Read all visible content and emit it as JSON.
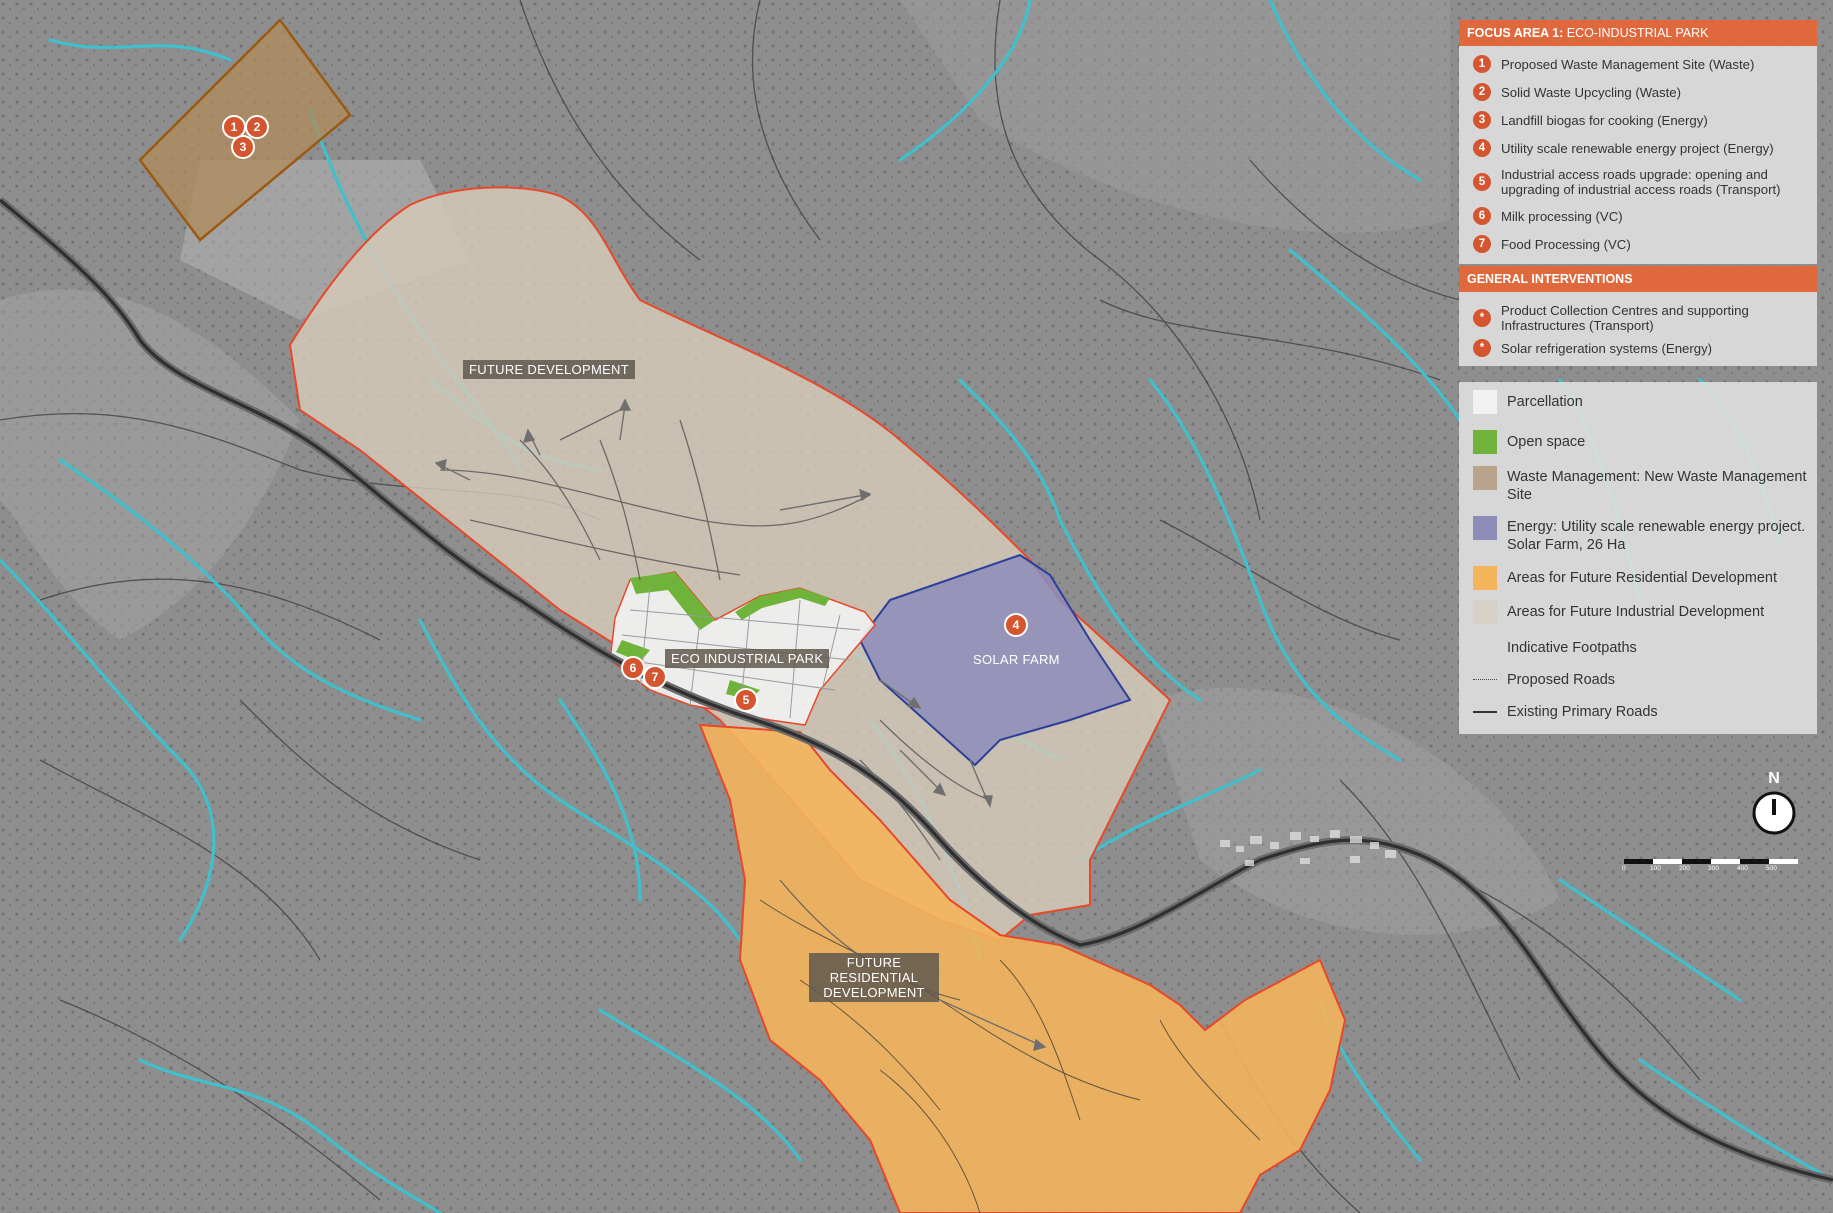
{
  "zones": {
    "future_development": "FUTURE DEVELOPMENT",
    "eco_industrial_park": "ECO INDUSTRIAL PARK",
    "solar_farm": "SOLAR FARM",
    "future_residential": "FUTURE RESIDENTIAL DEVELOPMENT"
  },
  "map_markers": {
    "m1": "1",
    "m2": "2",
    "m3": "3",
    "m4": "4",
    "m5": "5",
    "m6": "6",
    "m7": "7"
  },
  "legend": {
    "focus_area_prefix": "FOCUS AREA 1:",
    "focus_area_title": "ECO-INDUSTRIAL PARK",
    "focus_items": [
      {
        "num": "1",
        "label": "Proposed Waste Management Site (Waste)"
      },
      {
        "num": "2",
        "label": "Solid Waste Upcycling  (Waste)"
      },
      {
        "num": "3",
        "label": "Landfill biogas for cooking (Energy)"
      },
      {
        "num": "4",
        "label": "Utility scale renewable energy project (Energy)"
      },
      {
        "num": "5",
        "label": "Industrial access roads upgrade: opening and upgrading of industrial access roads (Transport)"
      },
      {
        "num": "6",
        "label": "Milk processing (VC)"
      },
      {
        "num": "7",
        "label": "Food Processing (VC)"
      }
    ],
    "general_title": "GENERAL INTERVENTIONS",
    "general_items": [
      {
        "num": "*",
        "label": "Product Collection Centres and supporting Infrastructures (Transport)"
      },
      {
        "num": "*",
        "label": "Solar refrigeration systems (Energy)"
      }
    ],
    "key_items": [
      {
        "label": "Parcellation",
        "color": "#f2f2f2",
        "kind": "fill"
      },
      {
        "label": "Open space",
        "color": "#6fb33a",
        "kind": "fill"
      },
      {
        "label": "Waste Management: New Waste Management Site",
        "color": "#b8a48a",
        "kind": "fill"
      },
      {
        "label": "Energy: Utility scale renewable energy project. Solar Farm, 26 Ha",
        "color": "#8d8cb8",
        "kind": "fill"
      },
      {
        "label": "Areas for Future Residential Development",
        "color": "#f4b45c",
        "kind": "fill"
      },
      {
        "label": "Areas for Future Industrial Development",
        "color": "#d7d1c6",
        "kind": "fill"
      },
      {
        "label": "Indicative Footpaths",
        "color": "#ffffff",
        "kind": "none"
      },
      {
        "label": "Proposed Roads",
        "color": "#555555",
        "kind": "dotted"
      },
      {
        "label": "Existing Primary Roads",
        "color": "#333333",
        "kind": "solid"
      }
    ]
  },
  "north_label": "N",
  "scale_labels": [
    "0",
    "100",
    "200",
    "300",
    "400",
    "500"
  ],
  "colors": {
    "accent": "#e0683d",
    "marker": "#d4552f",
    "river": "#3fc0cc",
    "zone_outline": "#e8482a",
    "road": "#2f2f2f"
  }
}
